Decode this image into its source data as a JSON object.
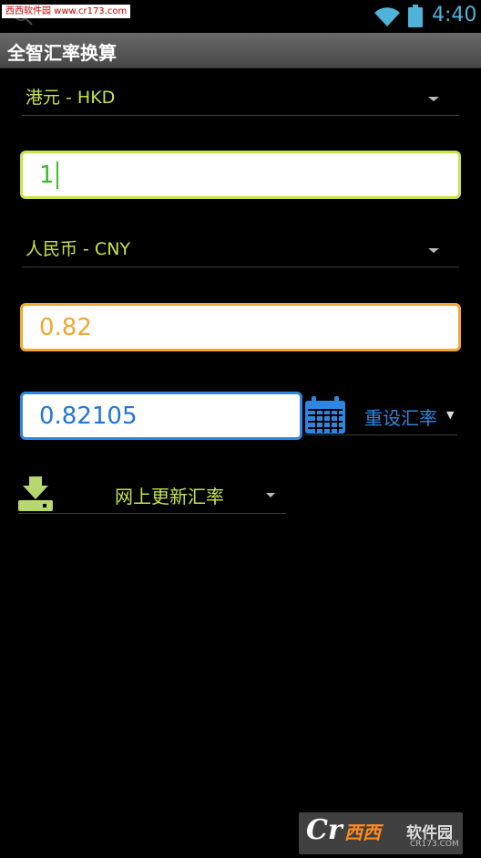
{
  "status_bar": {
    "watermark": "西西软件园 www.cr173.com",
    "time": "4:40",
    "accent_color": "#4fb3d9"
  },
  "action_bar": {
    "title": "全智汇率换算"
  },
  "converter": {
    "from_currency": "港元 - HKD",
    "amount": "1",
    "to_currency": "人民币 - CNY",
    "result": "0.82",
    "rate": "0.82105",
    "reset_rate_label": "重设汇率",
    "update_online_label": "网上更新汇率"
  },
  "colors": {
    "lime": "#c6e34d",
    "orange": "#f0a830",
    "blue": "#2f86e0",
    "green_text": "#3dbb2a"
  },
  "watermark_bottom": {
    "cr": "Cr",
    "logo": "西西",
    "site": "软件园",
    "url": "CR173.COM"
  }
}
